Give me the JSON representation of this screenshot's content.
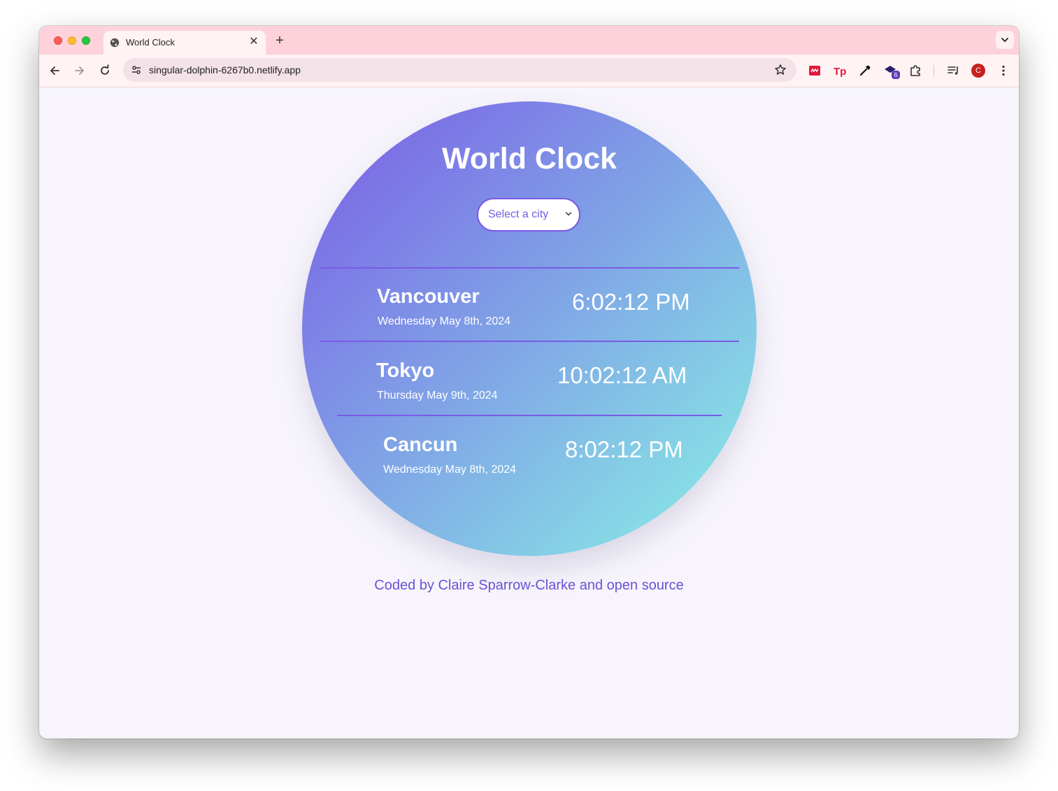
{
  "browser": {
    "tab_title": "World Clock",
    "tab_close_glyph": "✕",
    "new_tab_glyph": "+",
    "url": "singular-dolphin-6267b0.netlify.app",
    "extensions_badge": "6",
    "profile_initial": "C",
    "icons": [
      "back-icon",
      "forward-icon",
      "reload-icon",
      "site-settings-icon",
      "bookmark-star-icon",
      "extension-red-icon",
      "tp-extension-icon",
      "eyedropper-icon",
      "extension-badge-icon",
      "puzzle-icon",
      "media-icon",
      "profile-avatar",
      "menu-dots-icon"
    ]
  },
  "app": {
    "title": "World Clock",
    "select_placeholder": "Select a city",
    "cities": [
      {
        "name": "Vancouver",
        "date": "Wednesday May 8th, 2024",
        "time": "6:02:12 PM"
      },
      {
        "name": "Tokyo",
        "date": "Thursday May 9th, 2024",
        "time": "10:02:12 AM"
      },
      {
        "name": "Cancun",
        "date": "Wednesday May 8th, 2024",
        "time": "8:02:12 PM"
      }
    ]
  },
  "footer": {
    "prefix": "Coded by ",
    "author": "Claire Sparrow-Clarke",
    "middle": " and ",
    "source_link": "open source"
  },
  "colors": {
    "gradient_start": "#7a5be5",
    "gradient_end": "#89f2e6",
    "accent": "#6b52d6",
    "tab_bar": "#fdd2da"
  }
}
